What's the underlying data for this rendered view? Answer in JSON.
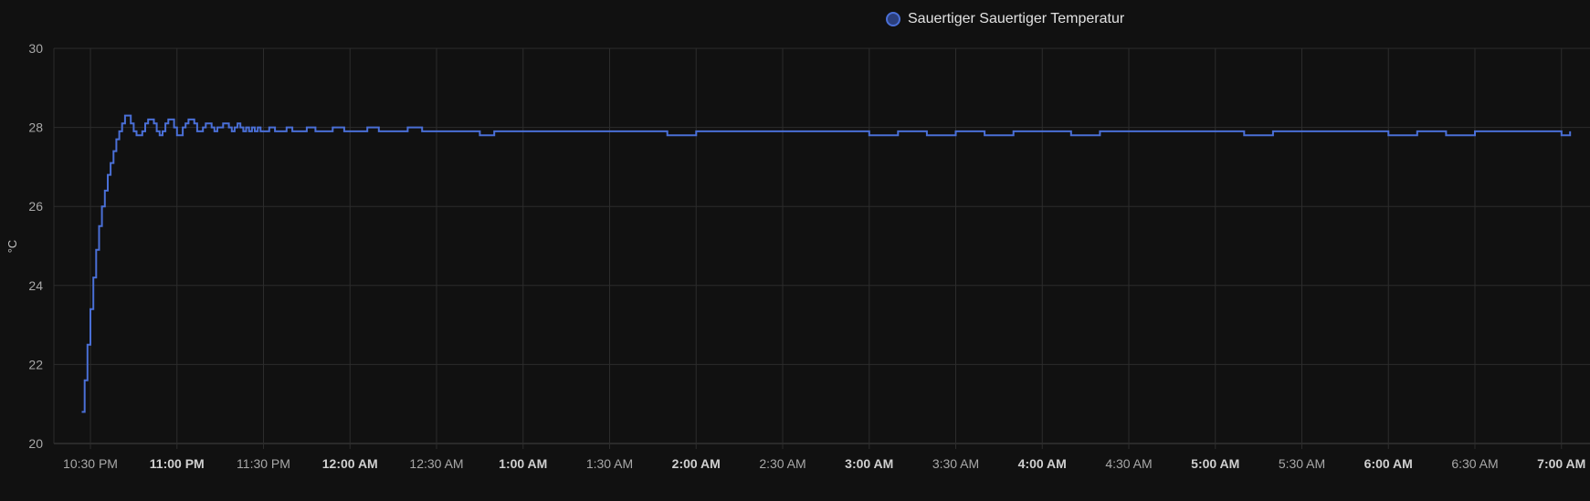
{
  "chart_data": {
    "type": "line",
    "ylabel": "°C",
    "ylim": [
      20,
      30
    ],
    "yticks": [
      20,
      22,
      24,
      26,
      28,
      30
    ],
    "grid": true,
    "legend_position": "top-center",
    "colors": {
      "background": "#111111",
      "grid": "#2c2c2c",
      "axis": "#444444",
      "series": "#4a6fd6",
      "swatch_fill": "#2b3f7c"
    },
    "xticks": [
      {
        "label": "10:30 PM",
        "t": 0,
        "bold": false
      },
      {
        "label": "11:00 PM",
        "t": 30,
        "bold": true
      },
      {
        "label": "11:30 PM",
        "t": 60,
        "bold": false
      },
      {
        "label": "12:00 AM",
        "t": 90,
        "bold": true
      },
      {
        "label": "12:30 AM",
        "t": 120,
        "bold": false
      },
      {
        "label": "1:00 AM",
        "t": 150,
        "bold": true
      },
      {
        "label": "1:30 AM",
        "t": 180,
        "bold": false
      },
      {
        "label": "2:00 AM",
        "t": 210,
        "bold": true
      },
      {
        "label": "2:30 AM",
        "t": 240,
        "bold": false
      },
      {
        "label": "3:00 AM",
        "t": 270,
        "bold": true
      },
      {
        "label": "3:30 AM",
        "t": 300,
        "bold": false
      },
      {
        "label": "4:00 AM",
        "t": 330,
        "bold": true
      },
      {
        "label": "4:30 AM",
        "t": 360,
        "bold": false
      },
      {
        "label": "5:00 AM",
        "t": 390,
        "bold": true
      },
      {
        "label": "5:30 AM",
        "t": 420,
        "bold": false
      },
      {
        "label": "6:00 AM",
        "t": 450,
        "bold": true
      },
      {
        "label": "6:30 AM",
        "t": 480,
        "bold": false
      },
      {
        "label": "7:00 AM",
        "t": 510,
        "bold": true
      }
    ],
    "series": [
      {
        "name": "Sauertiger Sauertiger Temperatur",
        "points": [
          [
            -3,
            20.8
          ],
          [
            -2,
            21.6
          ],
          [
            -1,
            22.5
          ],
          [
            0,
            23.4
          ],
          [
            1,
            24.2
          ],
          [
            2,
            24.9
          ],
          [
            3,
            25.5
          ],
          [
            4,
            26.0
          ],
          [
            5,
            26.4
          ],
          [
            6,
            26.8
          ],
          [
            7,
            27.1
          ],
          [
            8,
            27.4
          ],
          [
            9,
            27.7
          ],
          [
            10,
            27.9
          ],
          [
            11,
            28.1
          ],
          [
            12,
            28.3
          ],
          [
            13,
            28.3
          ],
          [
            14,
            28.1
          ],
          [
            15,
            27.9
          ],
          [
            16,
            27.8
          ],
          [
            17,
            27.8
          ],
          [
            18,
            27.9
          ],
          [
            19,
            28.1
          ],
          [
            20,
            28.2
          ],
          [
            21,
            28.2
          ],
          [
            22,
            28.1
          ],
          [
            23,
            27.9
          ],
          [
            24,
            27.8
          ],
          [
            25,
            27.9
          ],
          [
            26,
            28.1
          ],
          [
            27,
            28.2
          ],
          [
            28,
            28.2
          ],
          [
            29,
            28.0
          ],
          [
            30,
            27.8
          ],
          [
            31,
            27.8
          ],
          [
            32,
            28.0
          ],
          [
            33,
            28.1
          ],
          [
            34,
            28.2
          ],
          [
            35,
            28.2
          ],
          [
            36,
            28.1
          ],
          [
            37,
            27.9
          ],
          [
            38,
            27.9
          ],
          [
            39,
            28.0
          ],
          [
            40,
            28.1
          ],
          [
            41,
            28.1
          ],
          [
            42,
            28.0
          ],
          [
            43,
            27.9
          ],
          [
            44,
            28.0
          ],
          [
            45,
            28.0
          ],
          [
            46,
            28.1
          ],
          [
            47,
            28.1
          ],
          [
            48,
            28.0
          ],
          [
            49,
            27.9
          ],
          [
            50,
            28.0
          ],
          [
            51,
            28.1
          ],
          [
            52,
            28.0
          ],
          [
            53,
            27.9
          ],
          [
            54,
            28.0
          ],
          [
            55,
            27.9
          ],
          [
            56,
            28.0
          ],
          [
            57,
            27.9
          ],
          [
            58,
            28.0
          ],
          [
            59,
            27.9
          ],
          [
            60,
            27.9
          ],
          [
            62,
            28.0
          ],
          [
            64,
            27.9
          ],
          [
            66,
            27.9
          ],
          [
            68,
            28.0
          ],
          [
            70,
            27.9
          ],
          [
            72,
            27.9
          ],
          [
            75,
            28.0
          ],
          [
            78,
            27.9
          ],
          [
            80,
            27.9
          ],
          [
            84,
            28.0
          ],
          [
            88,
            27.9
          ],
          [
            92,
            27.9
          ],
          [
            96,
            28.0
          ],
          [
            100,
            27.9
          ],
          [
            105,
            27.9
          ],
          [
            110,
            28.0
          ],
          [
            115,
            27.9
          ],
          [
            120,
            27.9
          ],
          [
            130,
            27.9
          ],
          [
            135,
            27.8
          ],
          [
            140,
            27.9
          ],
          [
            150,
            27.9
          ],
          [
            160,
            27.9
          ],
          [
            170,
            27.9
          ],
          [
            180,
            27.9
          ],
          [
            190,
            27.9
          ],
          [
            200,
            27.8
          ],
          [
            210,
            27.9
          ],
          [
            220,
            27.9
          ],
          [
            230,
            27.9
          ],
          [
            240,
            27.9
          ],
          [
            250,
            27.9
          ],
          [
            260,
            27.9
          ],
          [
            270,
            27.8
          ],
          [
            280,
            27.9
          ],
          [
            290,
            27.8
          ],
          [
            300,
            27.9
          ],
          [
            310,
            27.8
          ],
          [
            320,
            27.9
          ],
          [
            330,
            27.9
          ],
          [
            340,
            27.8
          ],
          [
            350,
            27.9
          ],
          [
            360,
            27.9
          ],
          [
            370,
            27.9
          ],
          [
            380,
            27.9
          ],
          [
            390,
            27.9
          ],
          [
            400,
            27.8
          ],
          [
            410,
            27.9
          ],
          [
            420,
            27.9
          ],
          [
            430,
            27.9
          ],
          [
            440,
            27.9
          ],
          [
            450,
            27.8
          ],
          [
            460,
            27.9
          ],
          [
            470,
            27.8
          ],
          [
            480,
            27.9
          ],
          [
            490,
            27.9
          ],
          [
            500,
            27.9
          ],
          [
            510,
            27.8
          ],
          [
            513,
            27.9
          ]
        ]
      }
    ]
  }
}
